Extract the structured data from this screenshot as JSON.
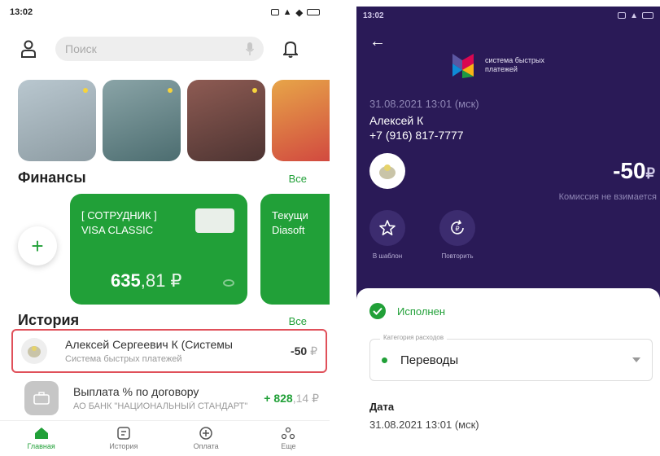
{
  "left": {
    "status": {
      "time": "13:02"
    },
    "search": {
      "placeholder": "Поиск"
    },
    "stories": [
      {
        "caption": "",
        "colors": [
          "#b9c7cf",
          "#8d9ca3"
        ]
      },
      {
        "caption": "",
        "colors": [
          "#8aa4a7",
          "#4c6d70"
        ]
      },
      {
        "caption": "",
        "colors": [
          "#8e5b53",
          "#4d3432"
        ]
      },
      {
        "caption": "",
        "colors": [
          "#e7a548",
          "#d0433f"
        ]
      }
    ],
    "finance": {
      "title": "Финансы",
      "all_label": "Все",
      "card1": {
        "title_line1": "[ СОТРУДНИК ]",
        "title_line2": "VISA CLASSIC",
        "amount_main": "635",
        "amount_frac": ",81 ₽"
      },
      "card2": {
        "title_line1": "Текущи",
        "title_line2": "Diasoft"
      }
    },
    "history": {
      "title": "История",
      "all_label": "Все",
      "items": [
        {
          "name": "Алексей Сергеевич К (Системы",
          "sub": "Система быстрых платежей",
          "amount_main": "-50",
          "amount_cur": " ₽"
        },
        {
          "name": "Выплата % по договору",
          "sub": "АО БАНК \"НАЦИОНАЛЬНЫЙ СТАНДАРТ\"",
          "amount_main": "+ 828",
          "amount_cur": ",14 ₽"
        }
      ]
    },
    "tabs": [
      {
        "label": "Главная"
      },
      {
        "label": "История"
      },
      {
        "label": "Оплата"
      },
      {
        "label": "Еще"
      }
    ]
  },
  "right": {
    "status": {
      "time": "13:02"
    },
    "sbp_label": "система быстрых платежей",
    "date": "31.08.2021 13:01 (мск)",
    "recipient_name": "Алексей К",
    "recipient_phone": "+7 (916) 817-7777",
    "amount_main": "-50",
    "amount_cur": "₽",
    "fee_text": "Комиссия не взимается",
    "actions": [
      {
        "label": "В шаблон"
      },
      {
        "label": "Повторить"
      }
    ],
    "status_text": "Исполнен",
    "category": {
      "legend": "Категория расходов",
      "value": "Переводы"
    },
    "date_label": "Дата",
    "date_value": "31.08.2021 13:01 (мск)"
  },
  "colors": {
    "brand_green": "#21a038",
    "sbp_bg": "#2a1a57",
    "highlight": "#e0505a"
  }
}
